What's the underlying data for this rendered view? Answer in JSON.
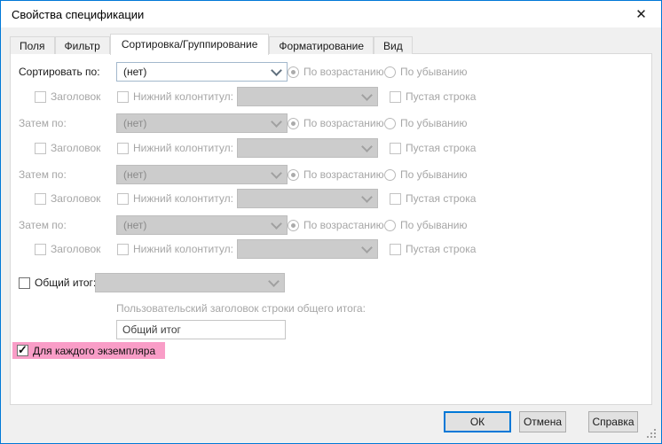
{
  "window": {
    "title": "Свойства спецификации",
    "close_icon": "✕"
  },
  "tabs": [
    {
      "label": "Поля",
      "active": false
    },
    {
      "label": "Фильтр",
      "active": false
    },
    {
      "label": "Сортировка/Группирование",
      "active": true
    },
    {
      "label": "Форматирование",
      "active": false
    },
    {
      "label": "Вид",
      "active": false
    }
  ],
  "sorting": {
    "none_value": "(нет)",
    "ascending_label": "По возрастанию",
    "descending_label": "По убыванию",
    "header_label": "Заголовок",
    "footer_label": "Нижний колонтитул:",
    "blank_line_label": "Пустая строка",
    "groups": [
      {
        "label": "Сортировать по:",
        "enabled": true,
        "value": "(нет)",
        "order": "ascending"
      },
      {
        "label": "Затем по:",
        "enabled": false,
        "value": "(нет)",
        "order": "ascending"
      },
      {
        "label": "Затем по:",
        "enabled": false,
        "value": "(нет)",
        "order": "ascending"
      },
      {
        "label": "Затем по:",
        "enabled": false,
        "value": "(нет)",
        "order": "ascending"
      }
    ]
  },
  "grand_total": {
    "label": "Общий итог:",
    "checked": false,
    "custom_header_label": "Пользовательский заголовок строки общего итога:",
    "custom_header_value": "Общий итог"
  },
  "per_instance": {
    "label": "Для каждого экземпляра",
    "checked": true,
    "highlight_color": "#f99dc7"
  },
  "footer": {
    "ok_label": "ОК",
    "cancel_label": "Отмена",
    "help_label": "Справка"
  },
  "colors": {
    "accent": "#0078d7",
    "highlight": "#f99dc7",
    "disabled_fill": "#cccccc",
    "disabled_text": "#a6a6a6"
  }
}
